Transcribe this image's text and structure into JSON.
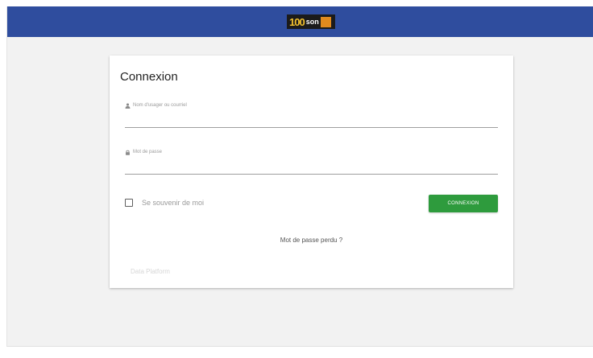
{
  "header": {
    "logo": {
      "number": "100",
      "word": "son",
      "colors": {
        "bar": "#2f4d9e",
        "number": "#f2c12e",
        "square": "#e08a1e"
      }
    }
  },
  "login_card": {
    "title": "Connexion",
    "username": {
      "label": "Nom d'usager ou courriel",
      "value": "",
      "icon": "user-icon"
    },
    "password": {
      "label": "Mot de passe",
      "value": "",
      "icon": "lock-icon"
    },
    "remember_me": {
      "label": "Se souvenir de moi",
      "checked": false
    },
    "submit_label": "CONNEXION",
    "submit_color": "#2e9b3d",
    "forgot_password": "Mot de passe perdu ?",
    "footer": "Data Platform"
  }
}
